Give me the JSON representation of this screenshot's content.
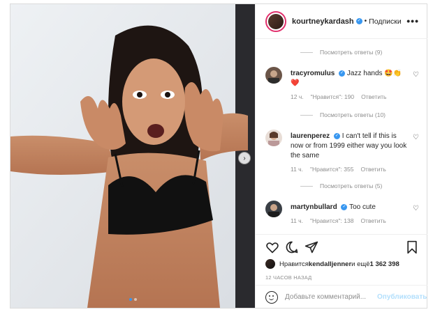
{
  "post": {
    "username": "kourtneykardash",
    "separator": "•",
    "follow_label": "Подписки",
    "more_label": "•••",
    "verified_icon": "verified-badge-icon",
    "accent_color": "#3897f0"
  },
  "comments": {
    "view_replies_1": "Посмотреть ответы (9)",
    "items": [
      {
        "username": "tracyromulus",
        "text": "Jazz hands 🤩👏❤️",
        "time": "12 ч.",
        "likes": "\"Нравится\": 190",
        "reply": "Ответить"
      },
      {
        "username": "laurenperez",
        "text": "I can't tell if this is now or from 1999 either way you look the same",
        "time": "11 ч.",
        "likes": "\"Нравится\": 355",
        "reply": "Ответить"
      },
      {
        "username": "martynbullard",
        "text": "Too cute",
        "time": "11 ч.",
        "likes": "\"Нравится\": 138",
        "reply": "Ответить"
      }
    ],
    "view_replies_2": "Посмотреть ответы (10)",
    "view_replies_3": "Посмотреть ответы (5)"
  },
  "actions": {
    "liked_by_prefix": "Нравится ",
    "liked_by_user": "kendalljenner",
    "liked_by_suffix": " и ещё ",
    "like_count": "1 362 398",
    "timestamp": "12 ЧАСОВ НАЗАД"
  },
  "composer": {
    "placeholder": "Добавьте комментарий...",
    "publish_label": "Опубликовать"
  },
  "carousel": {
    "current_slide": 1,
    "total_slides": 2
  }
}
